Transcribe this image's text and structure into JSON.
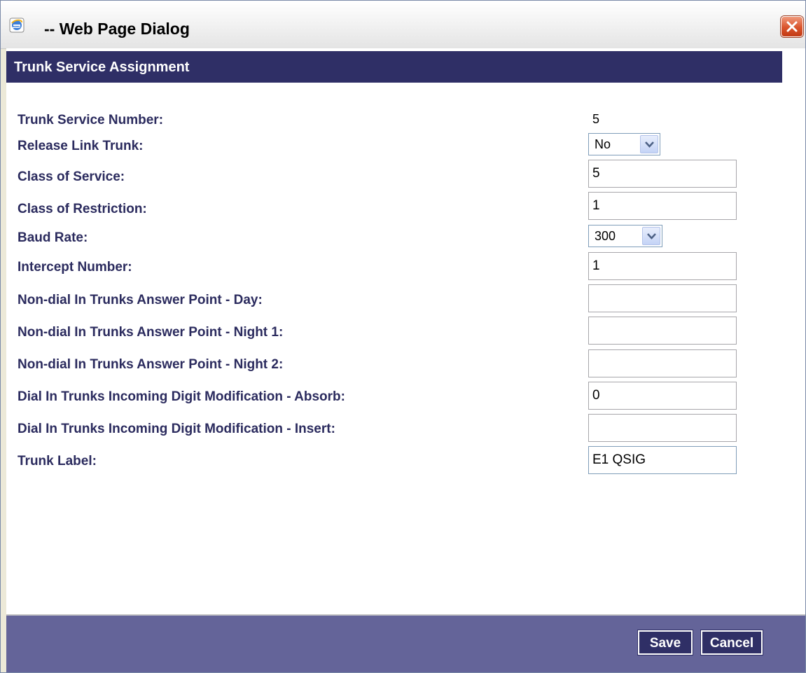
{
  "window": {
    "title": "-- Web Page Dialog"
  },
  "header": {
    "title": "Trunk Service Assignment"
  },
  "fields": {
    "trunk_service_number": {
      "label": "Trunk Service Number:",
      "value": "5"
    },
    "release_link_trunk": {
      "label": "Release Link Trunk:",
      "value": "No"
    },
    "class_of_service": {
      "label": "Class of Service:",
      "value": "5"
    },
    "class_of_restriction": {
      "label": "Class of Restriction:",
      "value": "1"
    },
    "baud_rate": {
      "label": "Baud Rate:",
      "value": "300"
    },
    "intercept_number": {
      "label": "Intercept Number:",
      "value": "1"
    },
    "answer_point_day": {
      "label": "Non-dial In Trunks Answer Point - Day:",
      "value": ""
    },
    "answer_point_night1": {
      "label": "Non-dial In Trunks Answer Point - Night 1:",
      "value": ""
    },
    "answer_point_night2": {
      "label": "Non-dial In Trunks Answer Point - Night 2:",
      "value": ""
    },
    "digit_mod_absorb": {
      "label": "Dial In Trunks Incoming Digit Modification - Absorb:",
      "value": "0"
    },
    "digit_mod_insert": {
      "label": "Dial In Trunks Incoming Digit Modification - Insert:",
      "value": ""
    },
    "trunk_label": {
      "label": "Trunk Label:",
      "value": "E1 QSIG"
    }
  },
  "footer": {
    "save_label": "Save",
    "cancel_label": "Cancel"
  },
  "icons": {
    "app": "ie-icon",
    "close": "close-icon",
    "dropdown": "chevron-down-icon"
  },
  "colors": {
    "header_band": "#2f2f66",
    "label_text": "#2b2b5e",
    "footer_band": "#646499",
    "button_bg": "#2f2f66",
    "close_button": "#d9532c"
  }
}
